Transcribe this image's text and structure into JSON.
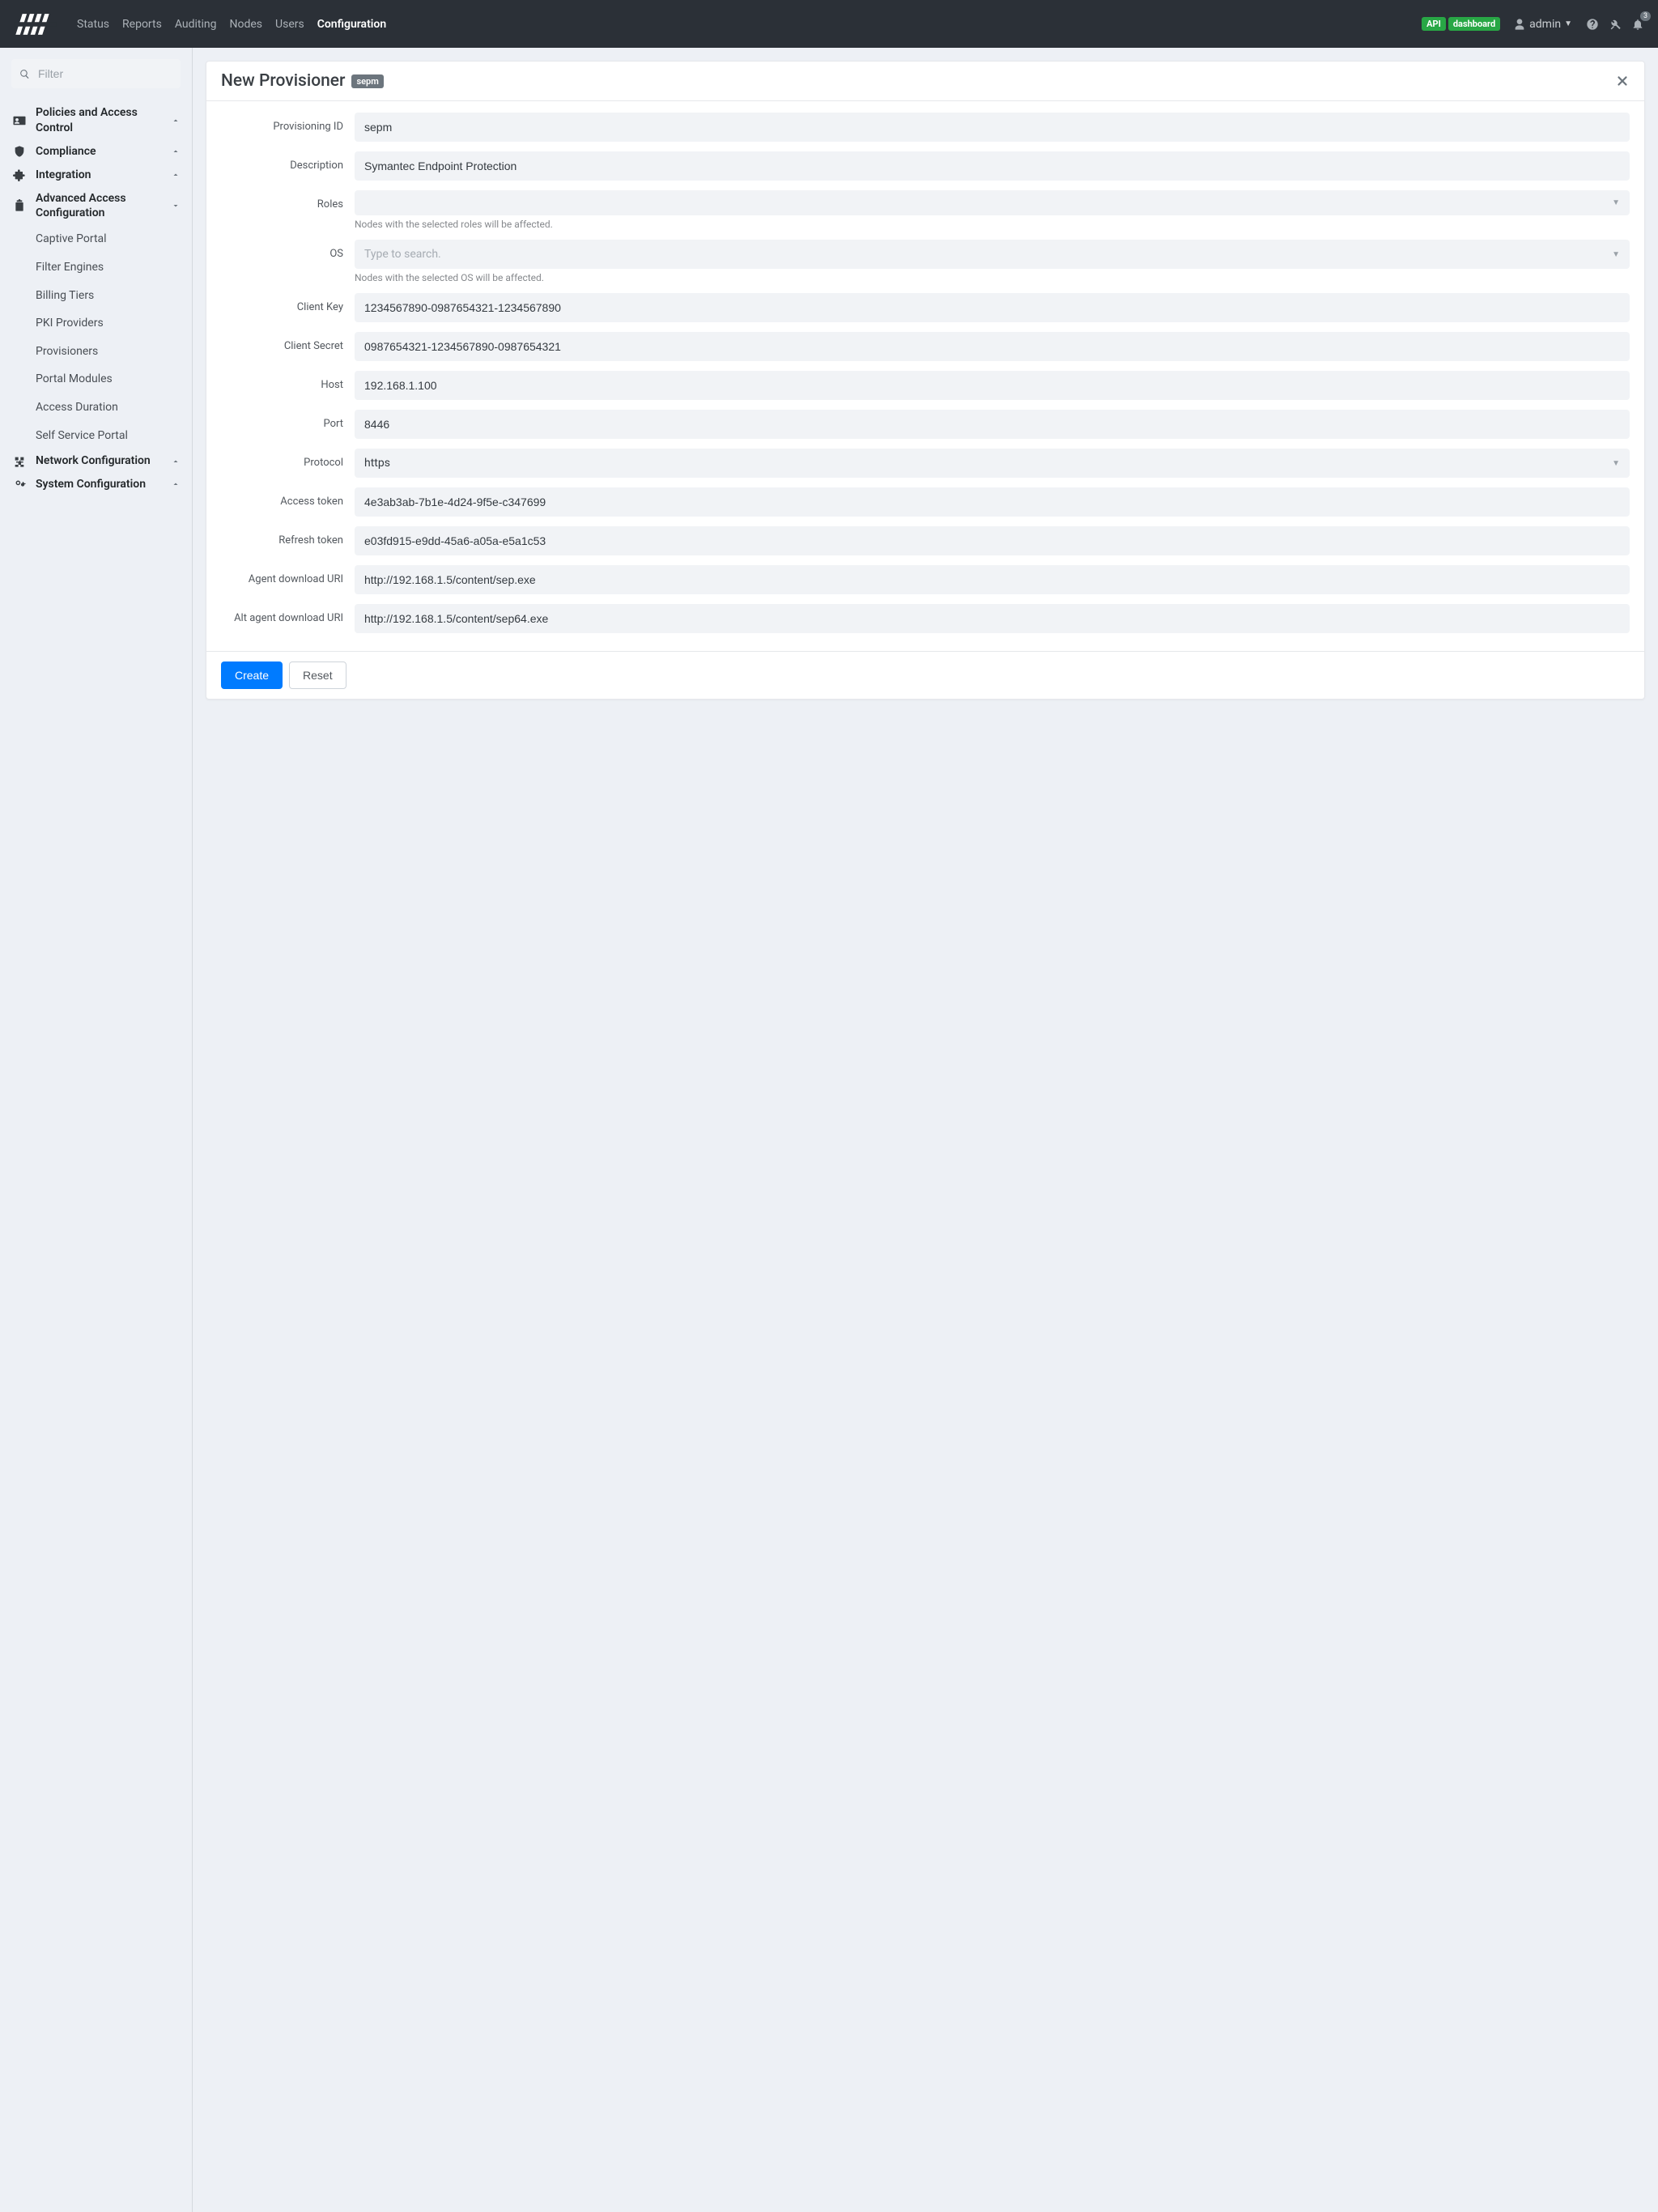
{
  "nav": {
    "tabs": [
      "Status",
      "Reports",
      "Auditing",
      "Nodes",
      "Users",
      "Configuration"
    ],
    "active_tab_index": 5,
    "api_label": "API",
    "dashboard_label": "dashboard",
    "username": "admin",
    "bell_count": "3"
  },
  "sidebar": {
    "filter_placeholder": "Filter",
    "sections": [
      {
        "label": "Policies and Access Control",
        "expanded": false
      },
      {
        "label": "Compliance",
        "expanded": false
      },
      {
        "label": "Integration",
        "expanded": false
      },
      {
        "label": "Advanced Access Configuration",
        "expanded": true,
        "items": [
          "Captive Portal",
          "Filter Engines",
          "Billing Tiers",
          "PKI Providers",
          "Provisioners",
          "Portal Modules",
          "Access Duration",
          "Self Service Portal"
        ]
      },
      {
        "label": "Network Configuration",
        "expanded": false
      },
      {
        "label": "System Configuration",
        "expanded": false
      }
    ]
  },
  "panel": {
    "title": "New Provisioner",
    "tag": "sepm",
    "fields": {
      "provisioning_id": {
        "label": "Provisioning ID",
        "value": "sepm"
      },
      "description": {
        "label": "Description",
        "value": "Symantec Endpoint Protection"
      },
      "roles": {
        "label": "Roles",
        "placeholder": "",
        "help": "Nodes with the selected roles will be affected."
      },
      "os": {
        "label": "OS",
        "placeholder": "Type to search.",
        "help": "Nodes with the selected OS will be affected."
      },
      "client_key": {
        "label": "Client Key",
        "value": "1234567890-0987654321-1234567890"
      },
      "client_secret": {
        "label": "Client Secret",
        "value": "0987654321-1234567890-0987654321"
      },
      "host": {
        "label": "Host",
        "value": "192.168.1.100"
      },
      "port": {
        "label": "Port",
        "value": "8446"
      },
      "protocol": {
        "label": "Protocol",
        "value": "https"
      },
      "access_token": {
        "label": "Access token",
        "value": "4e3ab3ab-7b1e-4d24-9f5e-c347699"
      },
      "refresh_token": {
        "label": "Refresh token",
        "value": "e03fd915-e9dd-45a6-a05a-e5a1c53"
      },
      "agent_uri": {
        "label": "Agent download URI",
        "value": "http://192.168.1.5/content/sep.exe"
      },
      "alt_agent_uri": {
        "label": "Alt agent download URI",
        "value": "http://192.168.1.5/content/sep64.exe"
      }
    },
    "buttons": {
      "create": "Create",
      "reset": "Reset"
    }
  }
}
